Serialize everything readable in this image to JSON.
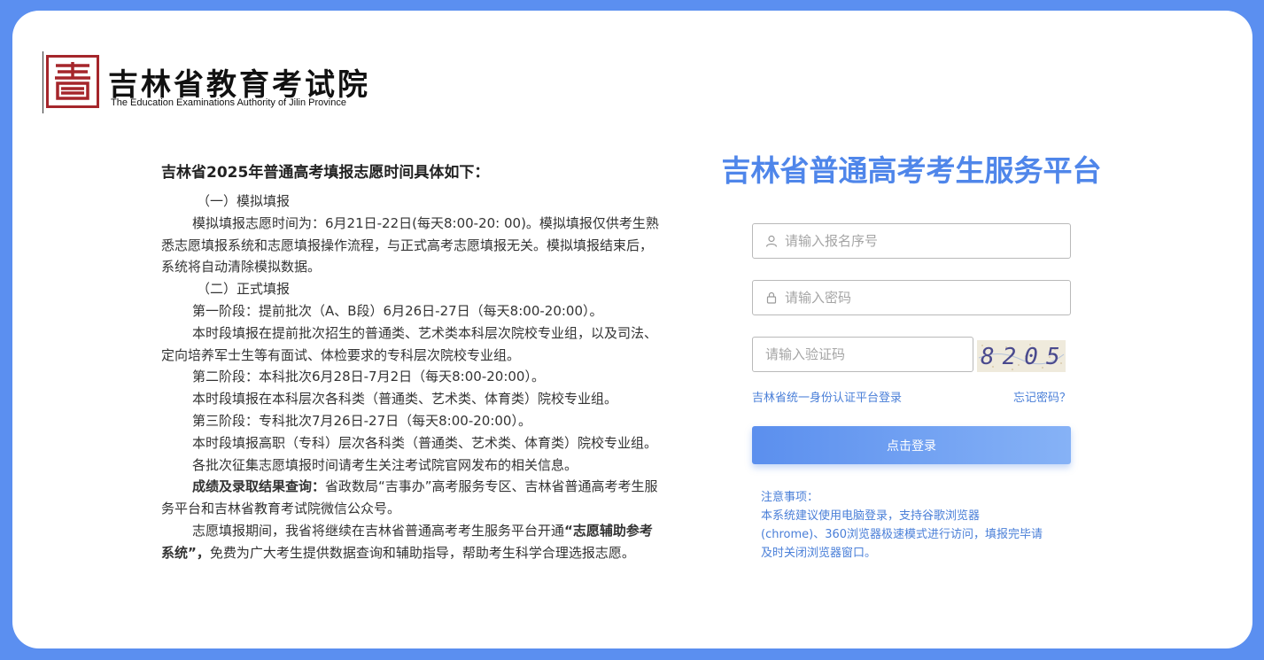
{
  "logo": {
    "cn_name": "吉林省教育考试院",
    "en_name": "The Education Examinations Authority of Jilin Province"
  },
  "notice": {
    "title": "吉林省2025年普通高考填报志愿时间具体如下：",
    "p1": "（一）模拟填报",
    "p2": "模拟填报志愿时间为：6月21日-22日(每天8:00-20: 00)。模拟填报仅供考生熟悉志愿填报系统和志愿填报操作流程，与正式高考志愿填报无关。模拟填报结束后，系统将自动清除模拟数据。",
    "p3": "（二）正式填报",
    "p4": "第一阶段：提前批次（A、B段）6月26日-27日（每天8:00-20:00）。",
    "p5": "本时段填报在提前批次招生的普通类、艺术类本科层次院校专业组，以及司法、定向培养军士生等有面试、体检要求的专科层次院校专业组。",
    "p6": "第二阶段：本科批次6月28日-7月2日（每天8:00-20:00）。",
    "p7": "本时段填报在本科层次各科类（普通类、艺术类、体育类）院校专业组。",
    "p8": "第三阶段：专科批次7月26日-27日（每天8:00-20:00）。",
    "p9": "本时段填报高职（专科）层次各科类（普通类、艺术类、体育类）院校专业组。",
    "p10": "各批次征集志愿填报时间请考生关注考试院官网发布的相关信息。",
    "p11_bold": "成绩及录取结果查询：",
    "p11_text": "省政数局“吉事办”高考服务专区、吉林省普通高考考生服务平台和吉林省教育考试院微信公众号。",
    "p12_a": "志愿填报期间，我省将继续在吉林省普通高考考生服务平台开通",
    "p12_bold": "“志愿辅助参考系统”，",
    "p12_b": "免费为广大考生提供数据查询和辅助指导，帮助考生科学合理选报志愿。"
  },
  "login": {
    "platform_title": "吉林省普通高考考生服务平台",
    "username_placeholder": "请输入报名序号",
    "password_placeholder": "请输入密码",
    "captcha_placeholder": "请输入验证码",
    "captcha_text": "8205",
    "unified_login_link": "吉林省统一身份认证平台登录",
    "forgot_password_link": "忘记密码？",
    "login_button": "点击登录",
    "tips_title": "注意事项：",
    "tips_line1": "本系统建议使用电脑登录，支持谷歌浏览器",
    "tips_line2": "(chrome)、360浏览器极速模式进行访问，填报完毕请",
    "tips_line3": "及时关闭浏览器窗口。"
  },
  "colors": {
    "background": "#5b8ff0",
    "accent": "#4f86ea",
    "seal_red": "#a5262b",
    "link": "#4a7fd8"
  }
}
